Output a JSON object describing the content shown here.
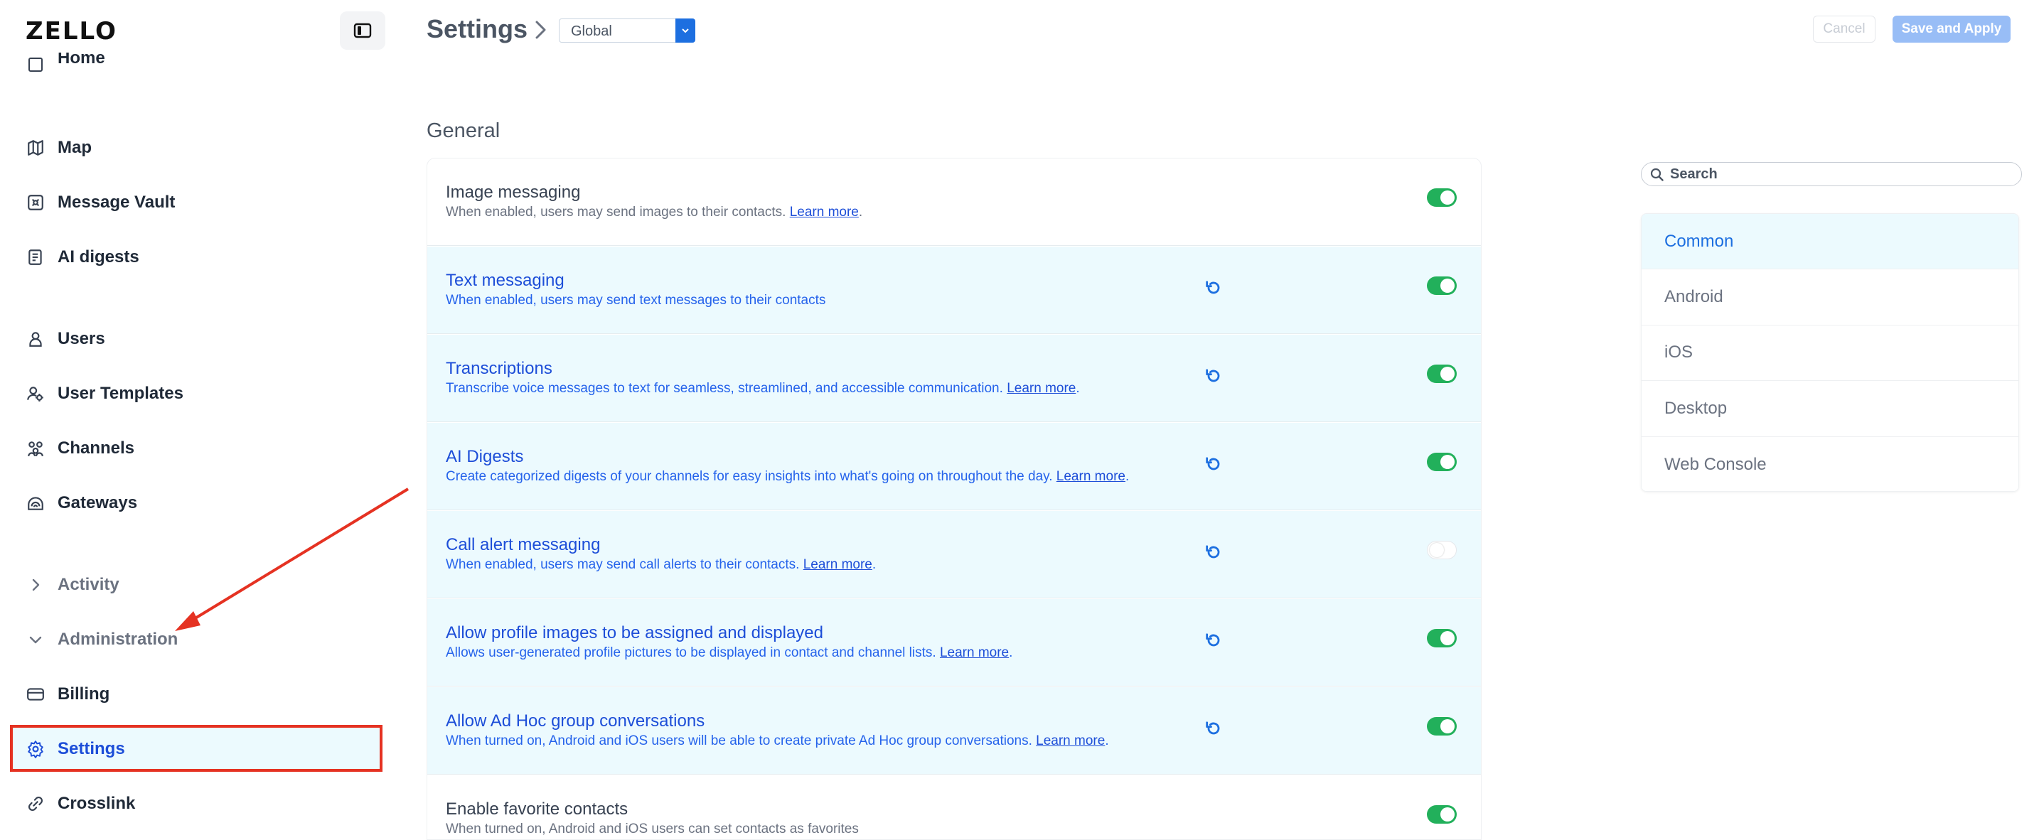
{
  "app": {
    "logo": "ZELLO"
  },
  "sidebar": {
    "items": [
      {
        "label": "Home",
        "icon": "home-icon"
      },
      {
        "label": "Map",
        "icon": "map-icon"
      },
      {
        "label": "Message Vault",
        "icon": "vault-icon"
      },
      {
        "label": "AI digests",
        "icon": "digest-icon"
      },
      {
        "label": "Users",
        "icon": "user-icon"
      },
      {
        "label": "User Templates",
        "icon": "user-template-icon"
      },
      {
        "label": "Channels",
        "icon": "channels-icon"
      },
      {
        "label": "Gateways",
        "icon": "gateway-icon"
      },
      {
        "label": "Activity",
        "icon": "chevron-right-icon"
      },
      {
        "label": "Administration",
        "icon": "chevron-down-icon"
      },
      {
        "label": "Billing",
        "icon": "billing-icon"
      },
      {
        "label": "Settings",
        "icon": "gear-icon"
      },
      {
        "label": "Crosslink",
        "icon": "link-icon"
      }
    ],
    "active": "Settings"
  },
  "header": {
    "title": "Settings",
    "scope": "Global",
    "cancel_label": "Cancel",
    "save_label": "Save and Apply"
  },
  "section": {
    "title": "General",
    "settings": [
      {
        "title": "Image messaging",
        "desc": "When enabled, users may send images to their contacts.",
        "link": "Learn more",
        "tail": ".",
        "modified": false,
        "enabled": true
      },
      {
        "title": "Text messaging",
        "desc": "When enabled, users may send text messages to their contacts",
        "link": "",
        "tail": "",
        "modified": true,
        "enabled": true
      },
      {
        "title": "Transcriptions",
        "desc": "Transcribe voice messages to text for seamless, streamlined, and accessible communication.",
        "link": "Learn more",
        "tail": ".",
        "modified": true,
        "enabled": true
      },
      {
        "title": "AI Digests",
        "desc": "Create categorized digests of your channels for easy insights into what's going on throughout the day.",
        "link": "Learn more",
        "tail": ".",
        "modified": true,
        "enabled": true
      },
      {
        "title": "Call alert messaging",
        "desc": "When enabled, users may send call alerts to their contacts.",
        "link": "Learn more",
        "tail": ".",
        "modified": true,
        "enabled": false
      },
      {
        "title": "Allow profile images to be assigned and displayed",
        "desc": "Allows user-generated profile pictures to be displayed in contact and channel lists.",
        "link": "Learn more",
        "tail": ".",
        "modified": true,
        "enabled": true
      },
      {
        "title": "Allow Ad Hoc group conversations",
        "desc": "When turned on, Android and iOS users will be able to create private Ad Hoc group conversations.",
        "link": "Learn more",
        "tail": ".",
        "modified": true,
        "enabled": true
      },
      {
        "title": "Enable favorite contacts",
        "desc": "When turned on, Android and iOS users can set contacts as favorites",
        "link": "",
        "tail": "",
        "modified": false,
        "enabled": true
      }
    ]
  },
  "right_panel": {
    "search_placeholder": "Search",
    "platforms": [
      "Common",
      "Android",
      "iOS",
      "Desktop",
      "Web Console"
    ],
    "active_platform": "Common"
  },
  "colors": {
    "accent": "#1d6fe0",
    "toggle_on": "#22b05b",
    "modified_bg": "#ecfafe",
    "highlight": "#e53222"
  }
}
